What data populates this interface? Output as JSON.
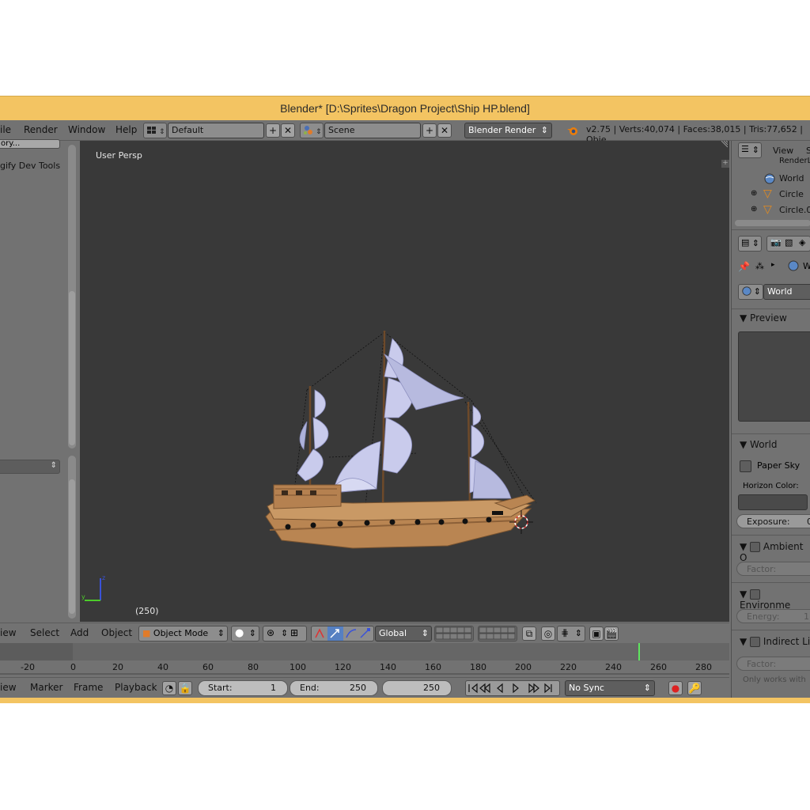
{
  "window": {
    "title": "Blender* [D:\\Sprites\\Dragon Project\\Ship HP.blend]"
  },
  "menubar": {
    "items": [
      "ile",
      "Render",
      "Window",
      "Help"
    ],
    "layout": "Default",
    "scene": "Scene",
    "engine": "Blender Render",
    "stats": "v2.75 | Verts:40,074 | Faces:38,015 | Tris:77,652 | Obje"
  },
  "left_panel": {
    "top_button": "ory...",
    "item": "gify Dev Tools"
  },
  "viewport": {
    "label": "User Persp",
    "frame": "(250)"
  },
  "view_toolbar": {
    "menus": [
      "iew",
      "Select",
      "Add",
      "Object"
    ],
    "mode": "Object Mode",
    "orientation": "Global"
  },
  "timeline": {
    "ticks": [
      "-20",
      "0",
      "20",
      "40",
      "60",
      "80",
      "100",
      "120",
      "140",
      "160",
      "180",
      "200",
      "220",
      "240",
      "260",
      "280"
    ],
    "current_frame": 250
  },
  "timeline_bar": {
    "menus": [
      "iew",
      "Marker",
      "Frame",
      "Playback"
    ],
    "start_label": "Start:",
    "start_value": "1",
    "end_label": "End:",
    "end_value": "250",
    "current_value": "250",
    "sync": "No Sync"
  },
  "outliner": {
    "view_label": "View",
    "s_label": "S",
    "items": [
      "RenderL",
      "World",
      "Circle",
      "Circle.0"
    ]
  },
  "properties": {
    "breadcrumb": "W",
    "world_field": "World",
    "preview_header": "Preview",
    "world_header": "World",
    "paper_sky": "Paper Sky",
    "horizon_label": "Horizon Color:",
    "exposure_label": "Exposure:",
    "exposure_value": "0",
    "ambient_header": "Ambient O",
    "factor_label": "Factor:",
    "environment_header": "Environme",
    "energy_label": "Energy:",
    "energy_value": "1",
    "indirect_header": "Indirect Li",
    "factor2_label": "Factor:",
    "only_works": "Only works with"
  },
  "colors": {
    "title_bar": "#f3c462",
    "viewport_bg": "#393939",
    "panel_bg": "#727272",
    "hull": "#b98552",
    "sail": "#c9cbec"
  }
}
